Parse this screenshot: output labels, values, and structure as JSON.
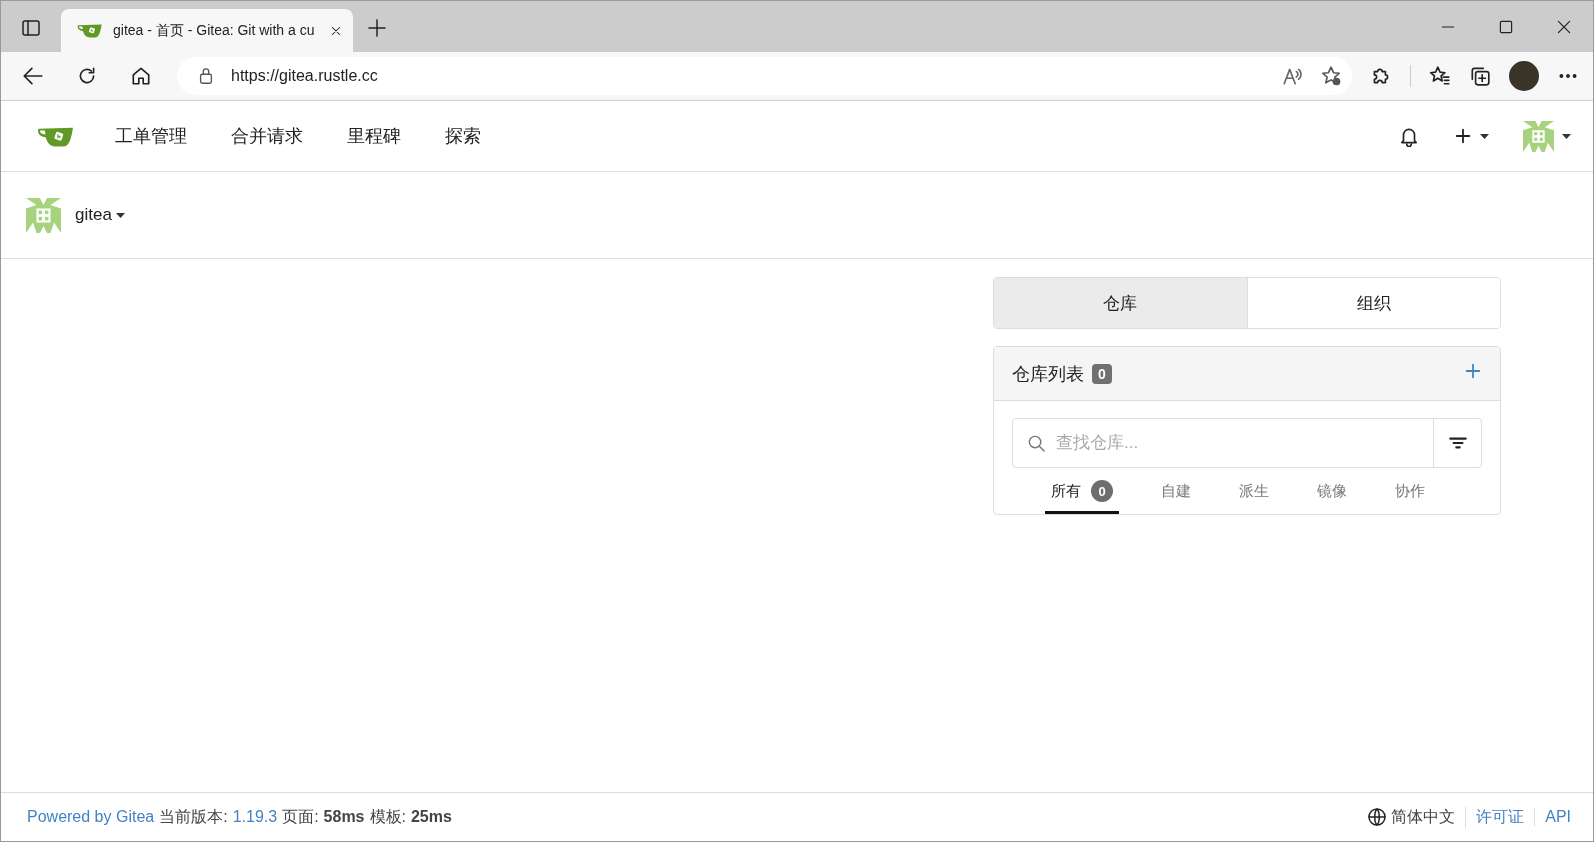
{
  "browser": {
    "tab_title": "gitea - 首页 - Gitea: Git with a cu",
    "address": "https://gitea.rustle.cc"
  },
  "nav": {
    "items": [
      {
        "label": "工单管理"
      },
      {
        "label": "合并请求"
      },
      {
        "label": "里程碑"
      },
      {
        "label": "探索"
      }
    ]
  },
  "user": {
    "name": "gitea"
  },
  "dashboard": {
    "tabs": [
      {
        "label": "仓库",
        "selected": true
      },
      {
        "label": "组织",
        "selected": false
      }
    ],
    "repo_list": {
      "title": "仓库列表",
      "count": "0",
      "search": {
        "placeholder": "查找仓库..."
      },
      "filters": [
        {
          "label": "所有",
          "count": "0",
          "selected": true
        },
        {
          "label": "自建",
          "selected": false
        },
        {
          "label": "派生",
          "selected": false
        },
        {
          "label": "镜像",
          "selected": false
        },
        {
          "label": "协作",
          "selected": false
        }
      ]
    }
  },
  "footer": {
    "left": [
      {
        "kind": "link",
        "text": "Powered by Gitea"
      },
      {
        "kind": "text",
        "text": "当前版本:"
      },
      {
        "kind": "link",
        "text": "1.19.3"
      },
      {
        "kind": "text",
        "text": "页面:"
      },
      {
        "kind": "bold",
        "text": "58ms"
      },
      {
        "kind": "text",
        "text": "模板:"
      },
      {
        "kind": "bold",
        "text": "25ms"
      }
    ],
    "right": [
      {
        "kind": "language",
        "text": "简体中文"
      },
      {
        "kind": "link",
        "text": "许可证"
      },
      {
        "kind": "link",
        "text": "API"
      }
    ]
  }
}
